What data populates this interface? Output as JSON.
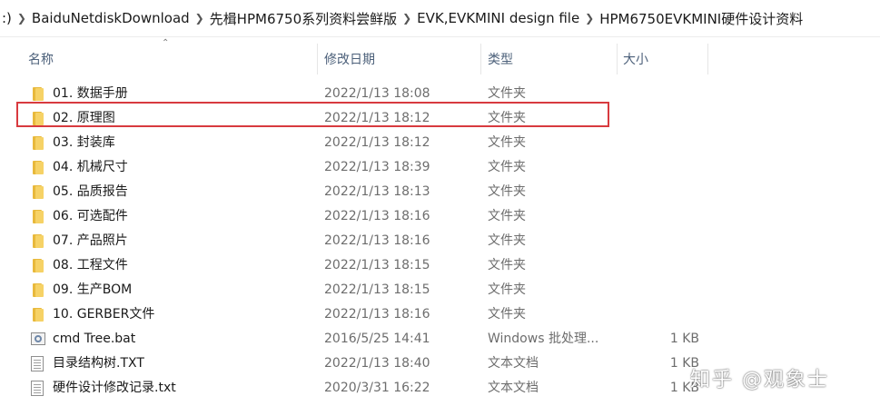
{
  "breadcrumb": {
    "lead": ":)",
    "items": [
      "BaiduNetdiskDownload",
      "先楫HPM6750系列资料尝鲜版",
      "EVK,EVKMINI design file",
      "HPM6750EVKMINI硬件设计资料"
    ]
  },
  "columns": {
    "name": "名称",
    "date": "修改日期",
    "type": "类型",
    "size": "大小"
  },
  "files": [
    {
      "icon": "folder-icon",
      "name": "01. 数据手册",
      "date": "2022/1/13 18:08",
      "type": "文件夹",
      "size": ""
    },
    {
      "icon": "folder-icon",
      "name": "02. 原理图",
      "date": "2022/1/13 18:12",
      "type": "文件夹",
      "size": "",
      "highlighted": true
    },
    {
      "icon": "folder-icon",
      "name": "03. 封装库",
      "date": "2022/1/13 18:12",
      "type": "文件夹",
      "size": ""
    },
    {
      "icon": "folder-icon",
      "name": "04. 机械尺寸",
      "date": "2022/1/13 18:39",
      "type": "文件夹",
      "size": ""
    },
    {
      "icon": "folder-icon",
      "name": "05. 品质报告",
      "date": "2022/1/13 18:13",
      "type": "文件夹",
      "size": ""
    },
    {
      "icon": "folder-icon",
      "name": "06. 可选配件",
      "date": "2022/1/13 18:16",
      "type": "文件夹",
      "size": ""
    },
    {
      "icon": "folder-icon",
      "name": "07. 产品照片",
      "date": "2022/1/13 18:16",
      "type": "文件夹",
      "size": ""
    },
    {
      "icon": "folder-icon",
      "name": "08. 工程文件",
      "date": "2022/1/13 18:15",
      "type": "文件夹",
      "size": ""
    },
    {
      "icon": "folder-icon",
      "name": "09. 生产BOM",
      "date": "2022/1/13 18:15",
      "type": "文件夹",
      "size": ""
    },
    {
      "icon": "folder-icon",
      "name": "10. GERBER文件",
      "date": "2022/1/13 18:16",
      "type": "文件夹",
      "size": ""
    },
    {
      "icon": "batch-file-icon",
      "name": "cmd Tree.bat",
      "date": "2016/5/25 14:41",
      "type": "Windows 批处理...",
      "size": "1 KB"
    },
    {
      "icon": "text-file-icon",
      "name": "目录结构树.TXT",
      "date": "2022/1/13 18:40",
      "type": "文本文档",
      "size": "1 KB"
    },
    {
      "icon": "text-file-icon",
      "name": "硬件设计修改记录.txt",
      "date": "2020/3/31 16:22",
      "type": "文本文档",
      "size": "1 KB"
    }
  ],
  "watermark": "知乎 @观象士",
  "colors": {
    "highlight_border": "#d83a3f",
    "header_text": "#4c607a",
    "folder": "#f6d266"
  }
}
